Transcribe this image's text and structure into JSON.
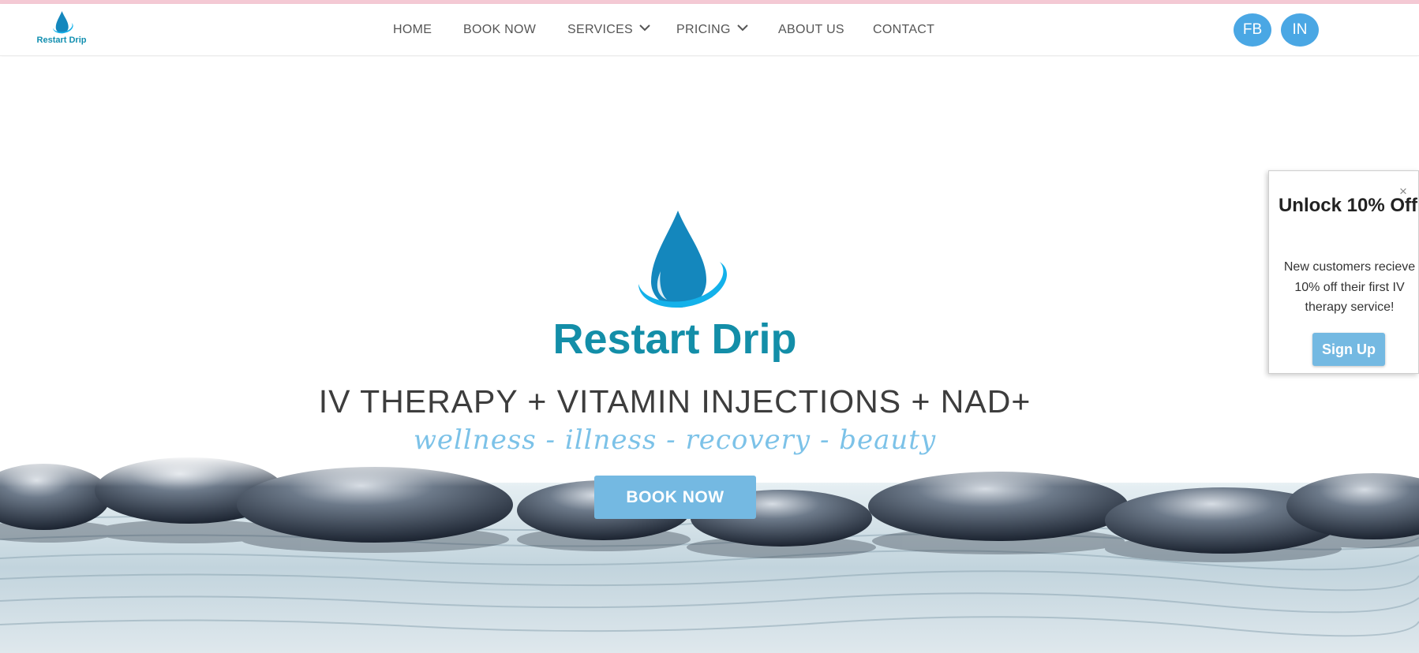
{
  "header": {
    "logo_text": "Restart Drip",
    "nav": [
      {
        "label": "HOME"
      },
      {
        "label": "BOOK NOW"
      },
      {
        "label": "SERVICES"
      },
      {
        "label": "PRICING"
      },
      {
        "label": "ABOUT US"
      },
      {
        "label": "CONTACT"
      }
    ],
    "social": [
      {
        "label": "FB"
      },
      {
        "label": "IN"
      }
    ]
  },
  "hero": {
    "brand": "Restart Drip",
    "headline": "IV THERAPY + VITAMIN INJECTIONS + NAD+",
    "tagline": "wellness - illness - recovery - beauty",
    "cta_label": "BOOK NOW"
  },
  "popup": {
    "close_symbol": "×",
    "title": "Unlock 10% Off",
    "text": "New customers recieve 10% off their first IV therapy service!",
    "button_label": "Sign Up"
  },
  "colors": {
    "brand_teal": "#138ea8",
    "drop_blue": "#1487bd",
    "ring_blue": "#13b1ea",
    "button_blue": "#74b9e2",
    "social_blue": "#4aa7e4",
    "tagline_blue": "#7cc2e8"
  },
  "icons": {
    "logo": "water-drop-with-ring-icon",
    "dropdown": "chevron-down-icon",
    "close": "close-icon"
  }
}
